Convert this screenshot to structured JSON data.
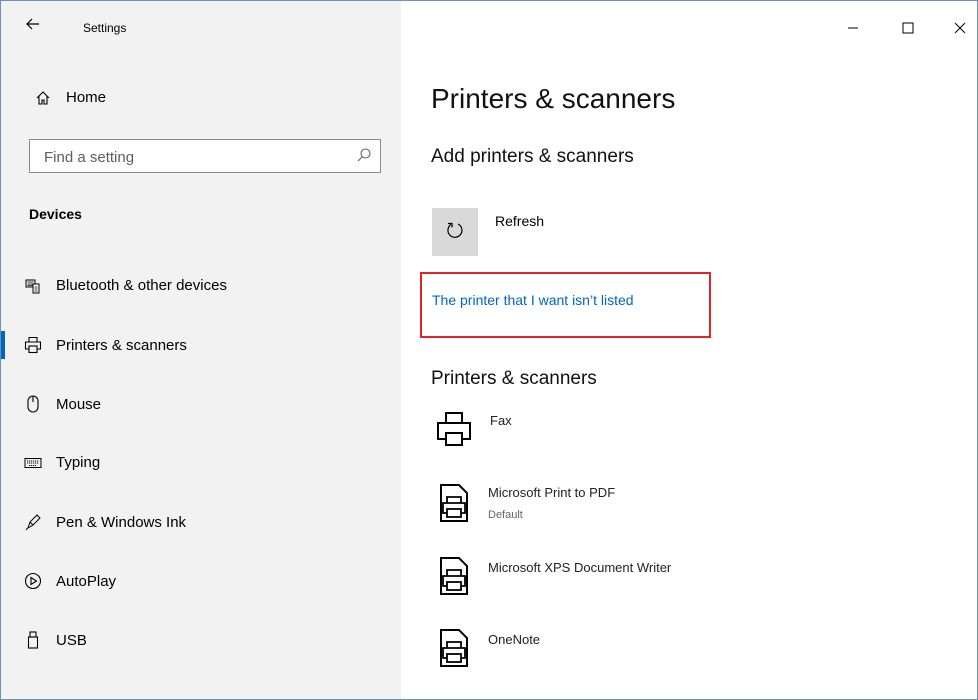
{
  "window": {
    "title": "Settings",
    "controls": {
      "minimize": "–",
      "maximize": "☐",
      "close": "✕"
    }
  },
  "sidebar": {
    "home_label": "Home",
    "search_placeholder": "Find a setting",
    "section_title": "Devices",
    "items": [
      {
        "label": "Bluetooth & other devices",
        "icon": "bluetooth-devices-icon"
      },
      {
        "label": "Printers & scanners",
        "icon": "printer-icon",
        "selected": true
      },
      {
        "label": "Mouse",
        "icon": "mouse-icon"
      },
      {
        "label": "Typing",
        "icon": "keyboard-icon"
      },
      {
        "label": "Pen & Windows Ink",
        "icon": "pen-icon"
      },
      {
        "label": "AutoPlay",
        "icon": "autoplay-icon"
      },
      {
        "label": "USB",
        "icon": "usb-icon"
      }
    ]
  },
  "main": {
    "page_title": "Printers & scanners",
    "add_heading": "Add printers & scanners",
    "refresh_label": "Refresh",
    "not_listed_link": "The printer that I want isn’t listed",
    "list_heading": "Printers & scanners",
    "printers": [
      {
        "name": "Fax",
        "status": ""
      },
      {
        "name": "Microsoft Print to PDF",
        "status": "Default"
      },
      {
        "name": "Microsoft XPS Document Writer",
        "status": ""
      },
      {
        "name": "OneNote",
        "status": ""
      }
    ]
  },
  "colors": {
    "accent": "#0067c0",
    "sidebar_bg": "#f2f2f2",
    "highlight_border": "#e0242a"
  }
}
